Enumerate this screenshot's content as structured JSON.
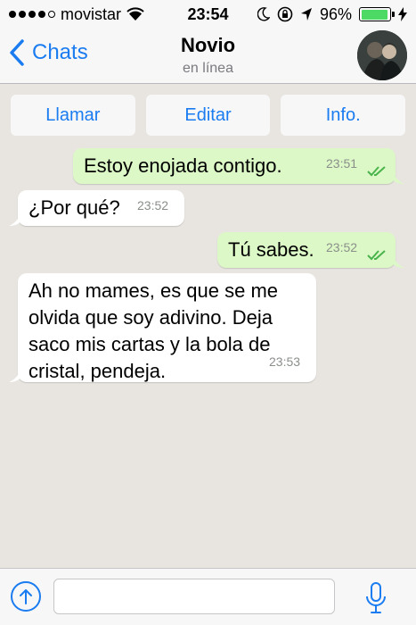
{
  "status_bar": {
    "carrier": "movistar",
    "time": "23:54",
    "battery_percent": "96%",
    "battery_level": 0.96,
    "signal_bars_filled": 4,
    "signal_bars_total": 5,
    "icons": [
      "wifi-icon",
      "moon-icon",
      "rotation-lock-icon",
      "location-icon",
      "battery-icon",
      "charging-bolt-icon"
    ]
  },
  "nav": {
    "back_label": "Chats",
    "contact_name": "Novio",
    "contact_status": "en línea"
  },
  "actions": {
    "call_label": "Llamar",
    "edit_label": "Editar",
    "info_label": "Info."
  },
  "messages": [
    {
      "direction": "outgoing",
      "text": "Estoy enojada contigo.",
      "time": "23:51",
      "read": true
    },
    {
      "direction": "incoming",
      "text": "¿Por qué?",
      "time": "23:52"
    },
    {
      "direction": "outgoing",
      "text": "Tú sabes.",
      "time": "23:52",
      "read": true
    },
    {
      "direction": "incoming",
      "lines": [
        "Ah no mames, es que se me",
        "olvida que soy adivino. Deja",
        "saco mis cartas y la bola de",
        "cristal, pendeja."
      ],
      "time": "23:53"
    }
  ],
  "input": {
    "value": "",
    "placeholder": ""
  },
  "colors": {
    "accent": "#1a7cf0",
    "outgoing_bubble": "#dcf8c6",
    "incoming_bubble": "#ffffff",
    "chat_background": "#e8e5e0",
    "read_ticks": "#4ab44c",
    "battery": "#4cd964"
  }
}
